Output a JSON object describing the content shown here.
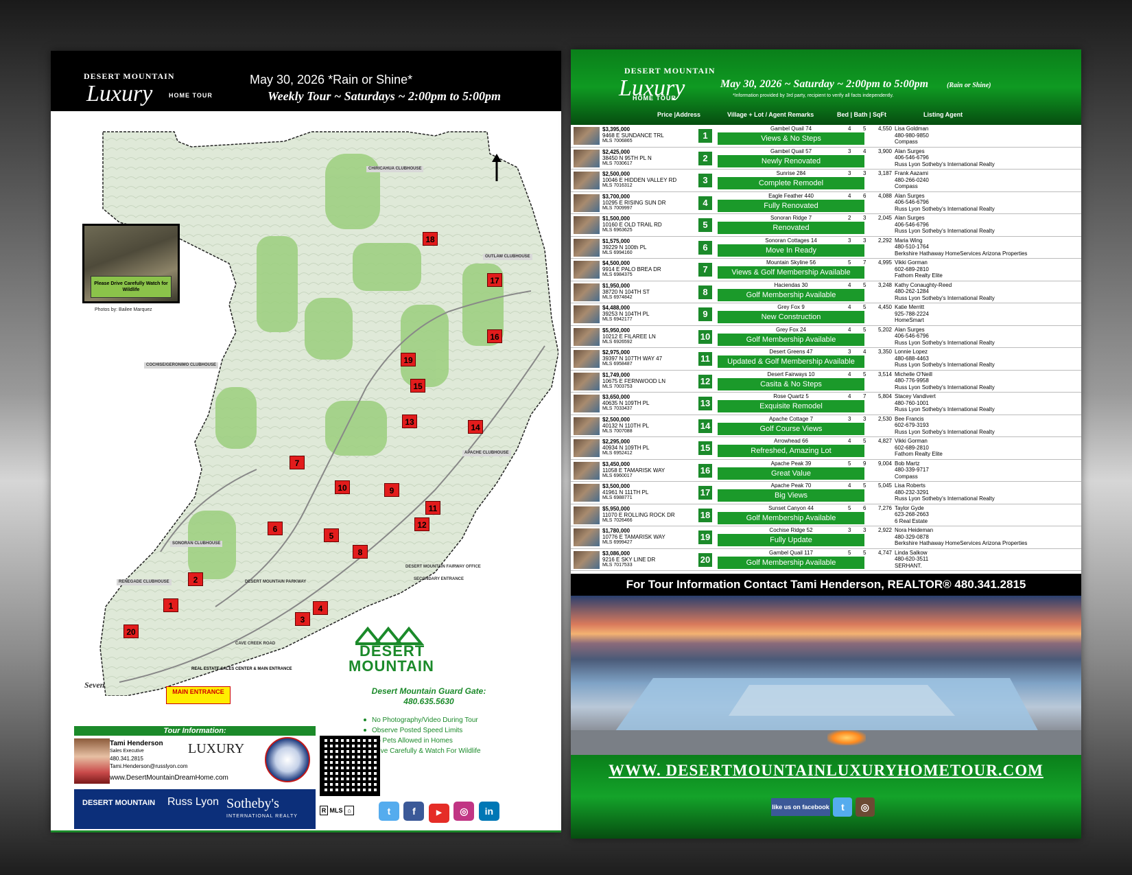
{
  "brand": {
    "line1": "DESERT MOUNTAIN",
    "line2": "Luxury",
    "line3": "HOME TOUR"
  },
  "left": {
    "date": "May 30, 2026 *Rain or Shine*",
    "weekly": "Weekly Tour ~ Saturdays ~ 2:00pm to 5:00pm",
    "wildlife_note": "Please Drive Carefully Watch for Wildlife",
    "photo_credit": "Photos by: Bailee Marquez",
    "main_entrance": "MAIN ENTRANCE",
    "sales_center": "REAL ESTATE SALES CENTER & MAIN ENTRANCE",
    "dm_logo": {
      "word1": "DESERT",
      "word2": "MOUNTAIN"
    },
    "guard_gate": {
      "label": "Desert Mountain Guard Gate:",
      "phone": "480.635.5630"
    },
    "rules": [
      "No Photography/Video During Tour",
      "Observe Posted Speed Limits",
      "No Pets Allowed in Homes",
      "Drive Carefully & Watch For Wildlife"
    ],
    "tour_info": {
      "heading": "Tour Information:",
      "name": "Tami Henderson",
      "title": "Sales Executive",
      "phone": "480.341.2815",
      "email": "Tami.Henderson@russlyon.com",
      "website": "www.DesertMountainDreamHome.com",
      "luxury_badge": "LUXURY"
    },
    "brand_bar": {
      "dm": "DESERT MOUNTAIN",
      "rl": "Russ Lyon",
      "sb": "Sotheby's",
      "ir": "INTERNATIONAL REALTY"
    },
    "eq_logos": "MLS",
    "map_labels": [
      {
        "id": "chiricahua",
        "text": "CHIRICAHUA CLUBHOUSE"
      },
      {
        "id": "outlaw",
        "text": "OUTLAW CLUBHOUSE"
      },
      {
        "id": "cochise",
        "text": "COCHISE/GERONIMO CLUBHOUSE"
      },
      {
        "id": "apache",
        "text": "APACHE CLUBHOUSE"
      },
      {
        "id": "sonoran",
        "text": "SONORAN CLUBHOUSE"
      },
      {
        "id": "renegade",
        "text": "RENEGADE CLUBHOUSE"
      },
      {
        "id": "fairway",
        "text": "DESERT MOUNTAIN FAIRWAY OFFICE"
      },
      {
        "id": "secondary",
        "text": "SECONDARY ENTRANCE"
      },
      {
        "id": "cavecreek",
        "text": "CAVE CREEK ROAD"
      },
      {
        "id": "dmpkwy",
        "text": "DESERT MOUNTAIN PARKWAY"
      },
      {
        "id": "seven",
        "text": "Seven"
      }
    ],
    "markers": [
      "1",
      "2",
      "3",
      "4",
      "5",
      "6",
      "7",
      "8",
      "9",
      "10",
      "11",
      "12",
      "13",
      "14",
      "15",
      "16",
      "17",
      "18",
      "19",
      "20"
    ]
  },
  "right": {
    "date": "May 30, 2026 ~ Saturday ~ 2:00pm to 5:00pm",
    "rain": "(Rain or Shine)",
    "disclaimer": "*Information provided by 3rd party, recipient to verify all facts independently.",
    "columns": {
      "price": "Price |Address",
      "village": "Village + Lot / Agent Remarks",
      "bedbath": "Bed  |  Bath  |  SqFt",
      "agent": "Listing  Agent"
    },
    "contact": "For Tour Information Contact Tami Henderson, REALTOR®  480.341.2815",
    "website": "WWW. DESERTMOUNTAINLUXURYHOMETOUR.COM",
    "fb_like": "like us on facebook"
  },
  "listings": [
    {
      "num": "1",
      "price": "$3,395,000",
      "addr": "9468 E SUNDANCE TRL",
      "mls": "MLS 7006865",
      "village": "Gambel Quail 74",
      "remark": "Views & No Steps",
      "bed": "4",
      "bath": "5",
      "sqft": "4,550",
      "agent": "Lisa Goldman",
      "agent_phone": "480-980-9850",
      "brokerage": "Compass"
    },
    {
      "num": "2",
      "price": "$2,425,000",
      "addr": "38450 N 95TH PL N",
      "mls": "MLS 7030617",
      "village": "Gambel Quail 57",
      "remark": "Newly Renovated",
      "bed": "3",
      "bath": "4",
      "sqft": "3,900",
      "agent": "Alan Surges",
      "agent_phone": "406-546-6796",
      "brokerage": "Russ Lyon Sotheby's International Realty"
    },
    {
      "num": "3",
      "price": "$2,500,000",
      "addr": "10046 E HIDDEN VALLEY RD",
      "mls": "MLS 7016312",
      "village": "Sunrise 284",
      "remark": "Complete Remodel",
      "bed": "3",
      "bath": "3",
      "sqft": "3,187",
      "agent": "Frank Aazami",
      "agent_phone": "480-266-0240",
      "brokerage": "Compass"
    },
    {
      "num": "4",
      "price": "$3,700,000",
      "addr": "10295 E RISING SUN DR",
      "mls": "MLS 7009997",
      "village": "Eagle Feather 440",
      "remark": "Fully Renovated",
      "bed": "4",
      "bath": "6",
      "sqft": "4,088",
      "agent": "Alan Surges",
      "agent_phone": "406-546-6796",
      "brokerage": "Russ Lyon Sotheby's International Realty"
    },
    {
      "num": "5",
      "price": "$1,500,000",
      "addr": "10160 E OLD TRAIL RD",
      "mls": "MLS 6963625",
      "village": "Sonoran Ridge 7",
      "remark": "Renovated",
      "bed": "2",
      "bath": "3",
      "sqft": "2,045",
      "agent": "Alan Surges",
      "agent_phone": "406-546-6796",
      "brokerage": "Russ Lyon Sotheby's International Realty"
    },
    {
      "num": "6",
      "price": "$1,575,000",
      "addr": "39229 N 100th PL",
      "mls": "MLS 6994160",
      "village": "Sonoran Cottages 14",
      "remark": "Move In Ready",
      "bed": "3",
      "bath": "3",
      "sqft": "2,292",
      "agent": "Maria Wing",
      "agent_phone": "480-510-1764",
      "brokerage": "Berkshire Hathaway HomeServices Arizona Properties"
    },
    {
      "num": "7",
      "price": "$4,500,000",
      "addr": "9914 E PALO BREA DR",
      "mls": "MLS 6984375",
      "village": "Mountain Skyline 56",
      "remark": "Views & Golf Membership Available",
      "bed": "5",
      "bath": "7",
      "sqft": "4,995",
      "agent": "Vikki Gorman",
      "agent_phone": "602-689-2810",
      "brokerage": "Fathom Realty Elite"
    },
    {
      "num": "8",
      "price": "$1,950,000",
      "addr": "38720 N 104TH ST",
      "mls": "MLS 6974842",
      "village": "Haciendas 30",
      "remark": "Golf Membership Available",
      "bed": "4",
      "bath": "5",
      "sqft": "3,248",
      "agent": "Kathy Conaughty-Reed",
      "agent_phone": "480-262-1284",
      "brokerage": "Russ Lyon Sotheby's International Realty"
    },
    {
      "num": "9",
      "price": "$4,488,000",
      "addr": "39253 N 104TH PL",
      "mls": "MLS 6942177",
      "village": "Grey Fox 9",
      "remark": "New Construction",
      "bed": "4",
      "bath": "5",
      "sqft": "4,450",
      "agent": "Katie Merritt",
      "agent_phone": "925-788-2224",
      "brokerage": "HomeSmart"
    },
    {
      "num": "10",
      "price": "$5,950,000",
      "addr": "10212 E FILAREE LN",
      "mls": "MLS 6926592",
      "village": "Grey Fox 24",
      "remark": "Golf Membership Available",
      "bed": "4",
      "bath": "5",
      "sqft": "5,202",
      "agent": "Alan Surges",
      "agent_phone": "406-546-6796",
      "brokerage": "Russ Lyon Sotheby's International Realty"
    },
    {
      "num": "11",
      "price": "$2,975,000",
      "addr": "39397 N 107TH WAY 47",
      "mls": "MLS 6958487",
      "village": "Desert Greens 47",
      "remark": "Updated & Golf Membership Available",
      "bed": "3",
      "bath": "4",
      "sqft": "3,350",
      "agent": "Lonnie Lopez",
      "agent_phone": "480-688-4463",
      "brokerage": "Russ Lyon Sotheby's International Realty"
    },
    {
      "num": "12",
      "price": "$1,749,000",
      "addr": "10675 E FERNWOOD LN",
      "mls": "MLS 7003753",
      "village": "Desert Fairways 10",
      "remark": "Casita & No Steps",
      "bed": "4",
      "bath": "5",
      "sqft": "3,514",
      "agent": "Michelle O'Neill",
      "agent_phone": "480-776-9958",
      "brokerage": "Russ Lyon Sotheby's International Realty"
    },
    {
      "num": "13",
      "price": "$3,650,000",
      "addr": "40635 N 109TH PL",
      "mls": "MLS 7033437",
      "village": "Rose Quartz 5",
      "remark": "Exquisite Remodel",
      "bed": "4",
      "bath": "7",
      "sqft": "5,804",
      "agent": "Stacey Vandivert",
      "agent_phone": "480-760-1001",
      "brokerage": "Russ Lyon Sotheby's International Realty"
    },
    {
      "num": "14",
      "price": "$2,500,000",
      "addr": "40132 N 110TH PL",
      "mls": "MLS 7007088",
      "village": "Apache Cottage 7",
      "remark": "Golf Course Views",
      "bed": "3",
      "bath": "3",
      "sqft": "2,530",
      "agent": "Bee Francis",
      "agent_phone": "602-679-3193",
      "brokerage": "Russ Lyon Sotheby's International Realty"
    },
    {
      "num": "15",
      "price": "$2,295,000",
      "addr": "40934 N 109TH PL",
      "mls": "MLS 6952412",
      "village": "Arrowhead 66",
      "remark": "Refreshed, Amazing Lot",
      "bed": "4",
      "bath": "5",
      "sqft": "4,827",
      "agent": "Vikki Gorman",
      "agent_phone": "602-689-2810",
      "brokerage": "Fathom Realty Elite"
    },
    {
      "num": "16",
      "price": "$3,450,000",
      "addr": "11058 E TAMARISK WAY",
      "mls": "MLS 6960017",
      "village": "Apache Peak 39",
      "remark": "Great Value",
      "bed": "5",
      "bath": "9",
      "sqft": "9,004",
      "agent": "Bob Martz",
      "agent_phone": "480-339-9717",
      "brokerage": "Compass"
    },
    {
      "num": "17",
      "price": "$3,500,000",
      "addr": "41961 N 111TH PL",
      "mls": "MLS 6988771",
      "village": "Apache Peak 70",
      "remark": "Big Views",
      "bed": "4",
      "bath": "5",
      "sqft": "5,045",
      "agent": "Lisa Roberts",
      "agent_phone": "480-232-3291",
      "brokerage": "Russ Lyon Sotheby's International Realty"
    },
    {
      "num": "18",
      "price": "$5,950,000",
      "addr": "11070 E ROLLING ROCK DR",
      "mls": "MLS 7026466",
      "village": "Sunset Canyon 44",
      "remark": "Golf Membership Available",
      "bed": "5",
      "bath": "6",
      "sqft": "7,276",
      "agent": "Taylor Gyde",
      "agent_phone": "623-268-2663",
      "brokerage": "6 Real Estate"
    },
    {
      "num": "19",
      "price": "$1,780,000",
      "addr": "10776 E TAMARISK WAY",
      "mls": "MLS 6999427",
      "village": "Cochise Ridge 52",
      "remark": "Fully Update",
      "bed": "3",
      "bath": "3",
      "sqft": "2,922",
      "agent": "Nora Heideman",
      "agent_phone": "480-329-0878",
      "brokerage": "Berkshire Hathaway HomeServices Arizona Properties"
    },
    {
      "num": "20",
      "price": "$3,086,000",
      "addr": "9216 E SKY LINE DR",
      "mls": "MLS 7017533",
      "village": "Gambel Quail 117",
      "remark": "Golf Membership Available",
      "bed": "5",
      "bath": "5",
      "sqft": "4,747",
      "agent": "Linda Salkow",
      "agent_phone": "480-620-3511",
      "brokerage": "SERHANT."
    }
  ],
  "colors": {
    "green": "#1b8a2a",
    "marker_red": "#e21c1c",
    "header_black": "#000000",
    "brand_blue": "#0c2f7a"
  }
}
